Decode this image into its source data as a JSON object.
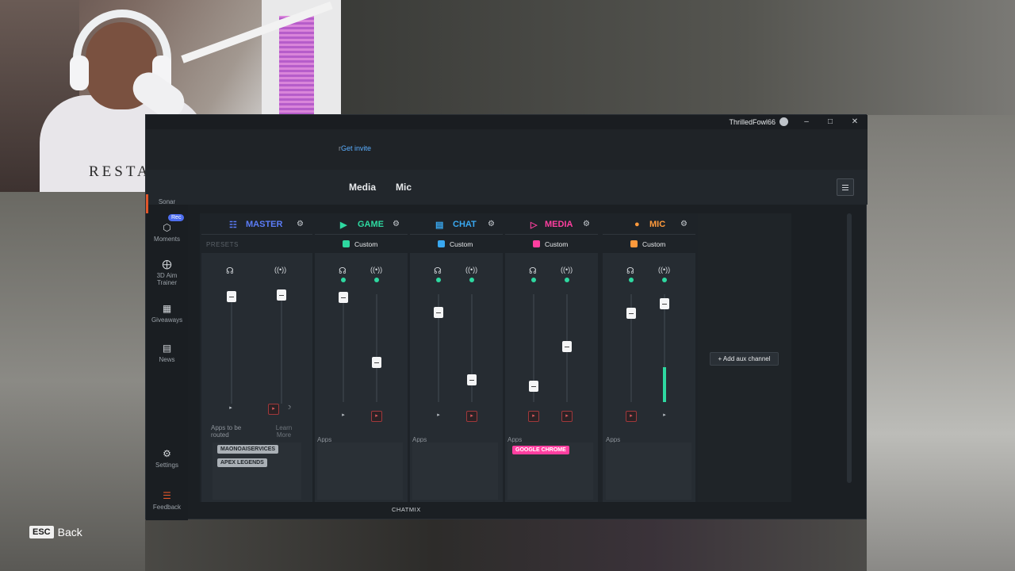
{
  "titlebar": {
    "username": "ThrilledFowl66"
  },
  "subbar": {
    "invite_prefix": "r",
    "invite_link": "Get invite"
  },
  "tabs": {
    "media": "Media",
    "mic": "Mic"
  },
  "webcam": {
    "shirt_text": "RESTART"
  },
  "sidebar": {
    "sonar": "Sonar",
    "rec_badge": "Rec",
    "moments": "Moments",
    "aim_trainer": "3D Aim Trainer",
    "giveaways": "Giveaways",
    "news": "News",
    "settings": "Settings",
    "feedback": "Feedback"
  },
  "mixer": {
    "presets_caption": "PRESETS",
    "channels": [
      {
        "name": "MASTER",
        "color": "#5b7cf7",
        "preset": "",
        "preset_color": ""
      },
      {
        "name": "GAME",
        "color": "#2ed8a0",
        "preset": "Custom",
        "preset_color": "#2ed8a0"
      },
      {
        "name": "CHAT",
        "color": "#39a8f0",
        "preset": "Custom",
        "preset_color": "#39a8f0"
      },
      {
        "name": "MEDIA",
        "color": "#ff3fa0",
        "preset": "Custom",
        "preset_color": "#ff3fa0"
      },
      {
        "name": "MIC",
        "color": "#ff9a3c",
        "preset": "Custom",
        "preset_color": "#ff9a3c"
      }
    ],
    "master_apps_label": "Apps to be routed",
    "learn_more": "Learn More",
    "apps_label": "Apps",
    "master_apps": [
      "MAONOAISERVICES",
      "APEX LEGENDS"
    ],
    "media_apps": [
      "GOOGLE CHROME"
    ],
    "add_aux": "+ Add aux channel",
    "chatmix": "CHATMIX"
  },
  "footer": {
    "esc_key": "ESC",
    "back": "Back"
  }
}
